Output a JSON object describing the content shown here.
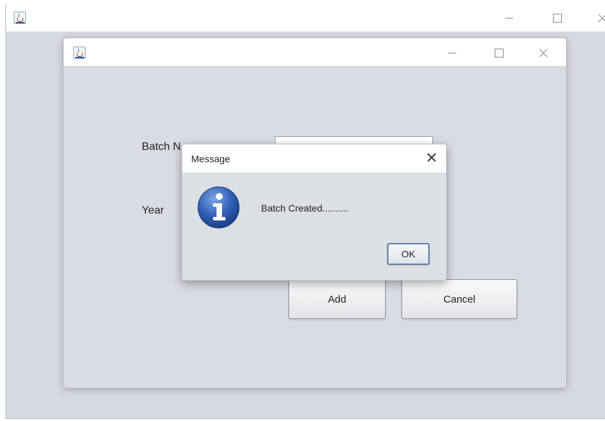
{
  "form": {
    "batch_label": "Batch N",
    "year_label": "Year",
    "add_button": "Add",
    "cancel_button": "Cancel"
  },
  "dialog": {
    "title": "Message",
    "message": "Batch Created..........",
    "ok_button": "OK",
    "icon": "info-icon"
  },
  "colors": {
    "window_bg": "#d6d9df",
    "titlebar_bg": "#ffffff",
    "info_icon_blue": "#2f5fb5"
  }
}
